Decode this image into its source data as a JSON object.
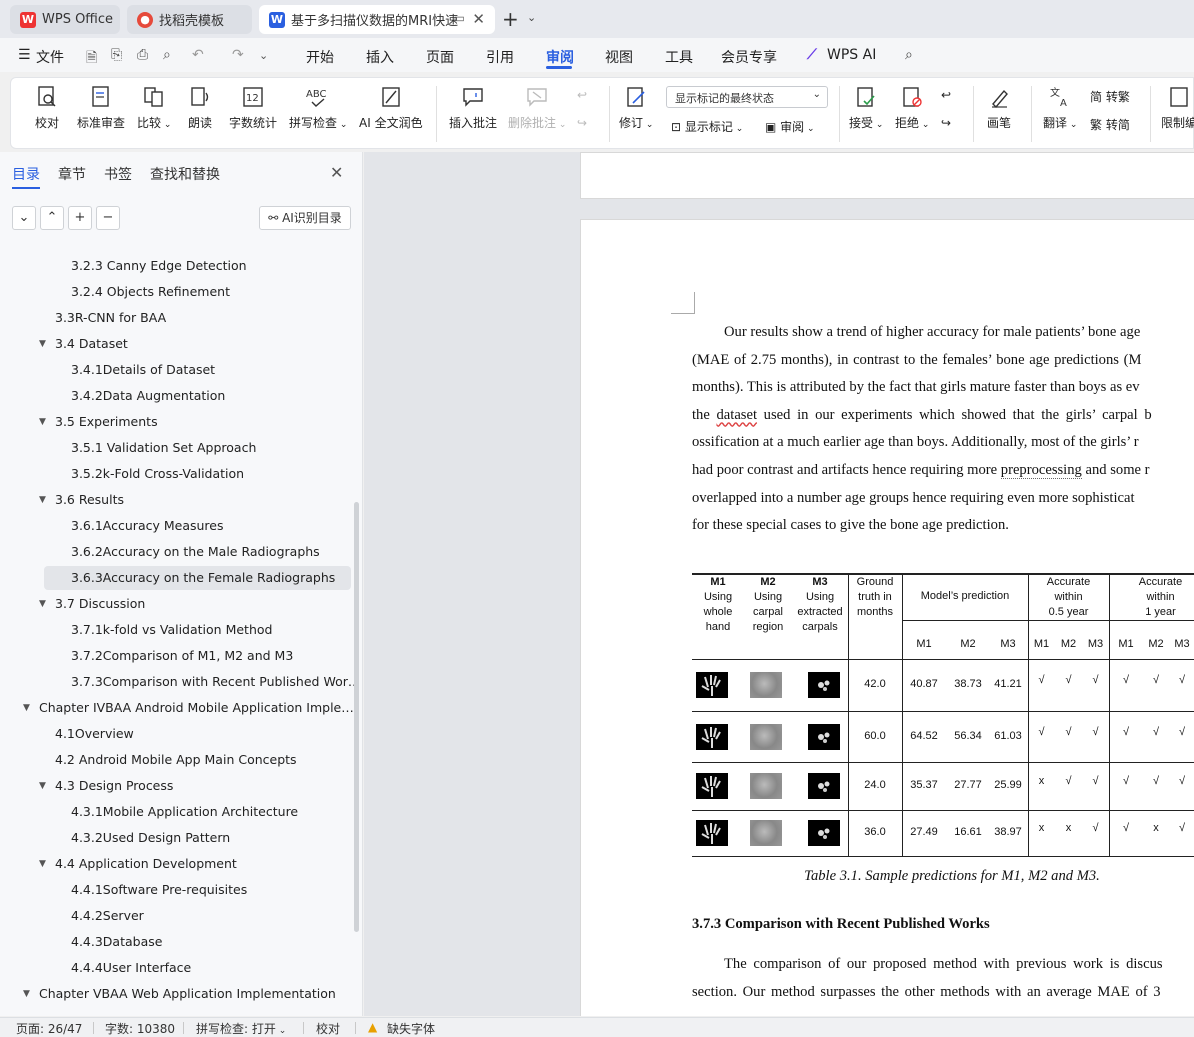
{
  "tabs": [
    {
      "label": "WPS Office",
      "icon": "wps-logo-icon"
    },
    {
      "label": "找稻壳模板",
      "icon": "docer-icon"
    },
    {
      "label": "基于多扫描仪数据的MRI快速",
      "icon": "word-doc-icon"
    }
  ],
  "menu": {
    "file": "文件",
    "items": [
      "开始",
      "插入",
      "页面",
      "引用",
      "审阅",
      "视图",
      "工具",
      "会员专享",
      "WPS AI"
    ],
    "active": "审阅"
  },
  "ribbon": {
    "proofread": "校对",
    "std_review": "标准审查",
    "compare": "比较",
    "read_aloud": "朗读",
    "word_count": "字数统计",
    "spell_check": "拼写检查",
    "ai_proofread": "AI 全文润色",
    "insert_comment": "插入批注",
    "delete_comment": "删除批注",
    "track": "修订",
    "markup_select": "显示标记的最终状态",
    "show_markup": "显示标记",
    "review": "审阅",
    "accept": "接受",
    "reject": "拒绝",
    "pen": "画笔",
    "translate": "翻译",
    "to_trad": "简 转繁",
    "to_simp": "繁 转简",
    "restrict": "限制编"
  },
  "sidebar": {
    "tabs": [
      "目录",
      "章节",
      "书签",
      "查找和替换"
    ],
    "ai_toc": "AI识别目录",
    "toc": [
      {
        "label": "3.2.3  Canny Edge Detection",
        "level": 3
      },
      {
        "label": "3.2.4  Objects Refinement",
        "level": 3
      },
      {
        "label": "3.3R-CNN for BAA",
        "level": 2
      },
      {
        "label": "3.4  Dataset",
        "level": 2,
        "expanded": true
      },
      {
        "label": "3.4.1Details of Dataset",
        "level": 3
      },
      {
        "label": "3.4.2Data Augmentation",
        "level": 3
      },
      {
        "label": "3.5  Experiments",
        "level": 2,
        "expanded": true
      },
      {
        "label": "3.5.1  Validation Set Approach",
        "level": 3
      },
      {
        "label": "3.5.2k-Fold Cross-Validation",
        "level": 3
      },
      {
        "label": "3.6  Results",
        "level": 2,
        "expanded": true
      },
      {
        "label": "3.6.1Accuracy Measures",
        "level": 3
      },
      {
        "label": "3.6.2Accuracy on the Male Radiographs",
        "level": 3
      },
      {
        "label": "3.6.3Accuracy on the Female Radiographs",
        "level": 3,
        "selected": true
      },
      {
        "label": "3.7  Discussion",
        "level": 2,
        "expanded": true
      },
      {
        "label": "3.7.1k-fold vs Validation Method",
        "level": 3
      },
      {
        "label": "3.7.2Comparison of M1, M2 and M3",
        "level": 3
      },
      {
        "label": "3.7.3Comparison with Recent Published Wor…",
        "level": 3
      },
      {
        "label": "Chapter IVBAA Android Mobile Application Imple…",
        "level": 1,
        "expanded": true
      },
      {
        "label": "4.1Overview",
        "level": 2
      },
      {
        "label": "4.2  Android Mobile App Main Concepts",
        "level": 2
      },
      {
        "label": "4.3  Design Process",
        "level": 2,
        "expanded": true
      },
      {
        "label": "4.3.1Mobile Application Architecture",
        "level": 3
      },
      {
        "label": "4.3.2Used Design Pattern",
        "level": 3
      },
      {
        "label": "4.4  Application Development",
        "level": 2,
        "expanded": true
      },
      {
        "label": "4.4.1Software Pre-requisites",
        "level": 3
      },
      {
        "label": "4.4.2Server",
        "level": 3
      },
      {
        "label": "4.4.3Database",
        "level": 3
      },
      {
        "label": "4.4.4User Interface",
        "level": 3
      },
      {
        "label": "Chapter VBAA Web Application Implementation",
        "level": 1,
        "expanded": true
      }
    ]
  },
  "document": {
    "para1": [
      "Our results show a trend of higher accuracy for male patients’ bone age",
      "(MAE of 2.75 months), in contrast to the females’ bone age predictions (M",
      "months). This is attributed by the fact that girls mature faster than boys as ev",
      "the dataset used in our experiments which showed that the girls’ carpal b",
      "ossification at a much earlier age than boys. Additionally, most of the girls’ r",
      "had poor contrast and artifacts hence requiring more preprocessing and some r",
      "overlapped into a number age groups hence requiring even more sophisticat",
      "for these special cases to give the bone age prediction."
    ],
    "table": {
      "h_m1": "M1",
      "h_m1_sub": "Using\nwhole\nhand",
      "h_m2": "M2",
      "h_m2_sub": "Using\ncarpal\nregion",
      "h_m3": "M3",
      "h_m3_sub": "Using\nextracted\ncarpals",
      "h_gt": "Ground\ntruth in\nmonths",
      "h_pred": "Model’s prediction",
      "h_acc05": "Accurate\nwithin\n0.5  year",
      "h_acc1": "Accurate\nwithin\n1 year",
      "sub": [
        "M1",
        "M2",
        "M3",
        "M1",
        "M2",
        "M3",
        "M1",
        "M2",
        "M3"
      ],
      "rows": [
        {
          "gt": "42.0",
          "pred": [
            "40.87",
            "38.73",
            "41.21"
          ],
          "acc05": [
            "√",
            "√",
            "√"
          ],
          "acc1": [
            "√",
            "√",
            "√"
          ]
        },
        {
          "gt": "60.0",
          "pred": [
            "64.52",
            "56.34",
            "61.03"
          ],
          "acc05": [
            "√",
            "√",
            "√"
          ],
          "acc1": [
            "√",
            "√",
            "√"
          ]
        },
        {
          "gt": "24.0",
          "pred": [
            "35.37",
            "27.77",
            "25.99"
          ],
          "acc05": [
            "x",
            "√",
            "√"
          ],
          "acc1": [
            "√",
            "√",
            "√"
          ]
        },
        {
          "gt": "36.0",
          "pred": [
            "27.49",
            "16.61",
            "38.97"
          ],
          "acc05": [
            "x",
            "x",
            "√"
          ],
          "acc1": [
            "√",
            "x",
            "√"
          ]
        }
      ]
    },
    "caption": "Table 3.1. Sample predictions for M1, M2 and M3.",
    "section": "3.7.3  Comparison with Recent Published Works",
    "para2": [
      "The comparison of our proposed method with previous work is discus",
      "section. Our method surpasses the other methods with an average MAE of 3"
    ]
  },
  "status": {
    "page": "页面: 26/47",
    "words": "字数: 10380",
    "spell": "拼写检查: 打开",
    "proof": "校对",
    "missing_font": "缺失字体"
  }
}
